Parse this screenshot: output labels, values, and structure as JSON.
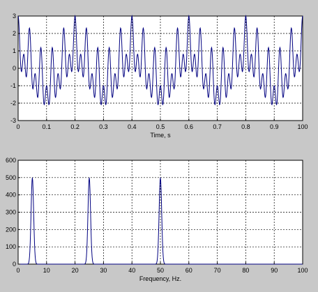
{
  "chart_data": [
    {
      "type": "line",
      "title": "",
      "xlabel": "Time, s",
      "ylabel": "",
      "xlim": [
        0,
        1.0
      ],
      "ylim": [
        -3,
        3
      ],
      "grid": true,
      "x_tick_values": [
        0,
        0.1,
        0.2,
        0.3,
        0.4,
        0.5,
        0.6,
        0.7,
        0.8,
        0.9,
        1.0
      ],
      "x_tick_labels": [
        "0",
        "0.1",
        "0.2",
        "0.3",
        "0.4",
        "0.5",
        "0.6",
        "0.7",
        "0.8",
        "0.9",
        "100"
      ],
      "y_tick_values": [
        -3,
        -2,
        -1,
        0,
        1,
        2,
        3
      ],
      "y_tick_labels": [
        "-3",
        "-2",
        "-1",
        "0",
        "1",
        "2",
        "3"
      ],
      "series": [
        {
          "color": "#000080",
          "components": [
            {
              "freq_hz": 5,
              "amplitude": 1.0
            },
            {
              "freq_hz": 25,
              "amplitude": 1.0
            },
            {
              "freq_hz": 50,
              "amplitude": 1.0
            }
          ],
          "sample_count": 1001
        }
      ]
    },
    {
      "type": "line",
      "title": "",
      "xlabel": "Frequency, Hz.",
      "ylabel": "",
      "xlim": [
        0,
        100
      ],
      "ylim": [
        0,
        600
      ],
      "grid": true,
      "x_tick_values": [
        0,
        10,
        20,
        30,
        40,
        50,
        60,
        70,
        80,
        90,
        100
      ],
      "x_tick_labels": [
        "0",
        "10",
        "20",
        "30",
        "40",
        "50",
        "60",
        "70",
        "80",
        "90",
        "100"
      ],
      "y_tick_values": [
        0,
        100,
        200,
        300,
        400,
        500,
        600
      ],
      "y_tick_labels": [
        "0",
        "100",
        "200",
        "300",
        "400",
        "500",
        "600"
      ],
      "series": [
        {
          "color": "#000080",
          "peaks": [
            {
              "freq_hz": 5,
              "magnitude": 500
            },
            {
              "freq_hz": 25,
              "magnitude": 500
            },
            {
              "freq_hz": 50,
              "magnitude": 500
            }
          ]
        }
      ]
    }
  ]
}
